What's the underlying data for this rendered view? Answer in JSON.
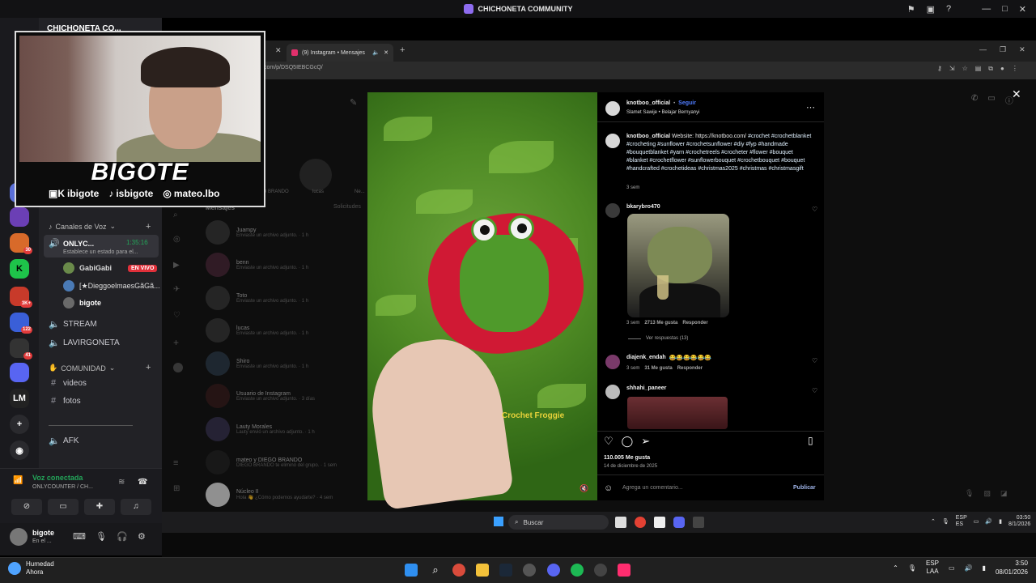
{
  "window": {
    "title": "CHICHONETA COMMUNITY"
  },
  "server": {
    "name": "CHICHONETA CO..."
  },
  "webcam": {
    "label": "BIGOTE",
    "socials": [
      {
        "icon": "twitch-kick-icon",
        "handle": "ibigote"
      },
      {
        "icon": "tiktok-icon",
        "handle": "isbigote"
      },
      {
        "icon": "instagram-icon",
        "handle": "mateo.lbo"
      }
    ]
  },
  "guild_badges": [
    "30",
    "3K+",
    "122",
    "41"
  ],
  "guild_letters": {
    "lm": "LM"
  },
  "channels": {
    "voice_header": "Canales de Voz",
    "active_voice": {
      "name": "ONLYC...",
      "timer": "1:35:16",
      "status": "Establece un estado para el..."
    },
    "members": [
      {
        "name": "GabiGabi",
        "live": "EN VIVO"
      },
      {
        "name": "[★Dieggoelmaes​Gã​Gã..."
      },
      {
        "name": "bigote"
      }
    ],
    "voice_channels": [
      "STREAM",
      "LAVIRGONETA"
    ],
    "community_header": "COMUNIDAD",
    "text_channels": [
      "videos",
      "fotos"
    ],
    "afk": "AFK"
  },
  "voice_panel": {
    "status": "Voz conectada",
    "channel": "ONLYCOUNTER / CH..."
  },
  "user_bar": {
    "name": "bigote",
    "status": "En el ..."
  },
  "browser": {
    "tab_title": "(9) Instagram • Mensajes",
    "url": "com/p/DSQ5IEBCGcQ/"
  },
  "instagram": {
    "messages_header": "Mensajes",
    "requests": "Solicitudes",
    "stories": [
      "DIEGO BRANDO",
      "lucas",
      "Ne..."
    ],
    "dms": [
      {
        "name": "Juampy",
        "sub": "Enviaste un archivo adjunto. · 1 h"
      },
      {
        "name": "benn",
        "sub": "Enviaste un archivo adjunto. · 1 h"
      },
      {
        "name": "Toto",
        "sub": "Enviaste un archivo adjunto. · 1 h"
      },
      {
        "name": "lucas",
        "sub": "Enviaste un archivo adjunto. · 1 h"
      },
      {
        "name": "Shiro",
        "sub": "Enviaste un archivo adjunto. · 1 h"
      },
      {
        "name": "Usuario de Instagram",
        "sub": "Enviaste un archivo adjunto. · 3 días"
      },
      {
        "name": "Lauty Morales",
        "sub": "Lauty envió un archivo adjunto. · 1 h"
      },
      {
        "name": "mateo y DIEGO BRANDO",
        "sub": "DIEGO BRANDO te eliminó del grupo. · 1 sem"
      },
      {
        "name": "Núcleo II",
        "sub": "Hola 👋 ¿Cómo podemos ayudarte? · 4 sem"
      }
    ],
    "post": {
      "username": "knotboo_official",
      "follow": "Seguir",
      "audio": "Slamet Sawije • Belajar Bernyanyi",
      "caption_prefix": "Website: https://knotboo.com/",
      "hashtags": "#crochet #crochetblanket #crocheting #sunflower #crochetsunflower #diy #fyp #handmade #bouquetblanket #yarn #crochetreels #crocheter #flower #bouquet #blanket #crochetflower #sunflowerbouquet #crochetbouquet #bouquet #handcrafted #crochetideas #christmas2025 #christmas #christmasgift",
      "caption_time": "3 sem",
      "image_overlay_text": "Crochet Froggie",
      "comments": [
        {
          "user": "bkarybro470",
          "time": "3 sem",
          "likes": "2713 Me gusta",
          "reply": "Responder",
          "view_replies": "Ver respuestas (13)"
        },
        {
          "user": "diajenk_endah",
          "text": "😂😂😂😂😂😂",
          "time": "3 sem",
          "likes": "31 Me gusta",
          "reply": "Responder"
        },
        {
          "user": "shhahi_paneer"
        }
      ],
      "likes": "110.005 Me gusta",
      "date": "14 de diciembre de 2025",
      "comment_placeholder": "Agrega un comentario...",
      "publish": "Publicar"
    }
  },
  "inner_taskbar": {
    "search": "Buscar",
    "lang": "ESP\nES",
    "time": "03:50",
    "date": "8/1/2026"
  },
  "taskbar": {
    "weather": {
      "label": "Humedad",
      "sub": "Ahora"
    },
    "lang_top": "ESP",
    "lang_bottom": "LAA",
    "time": "3:50",
    "date": "08/01/2026"
  },
  "colors": {
    "instagram_blue": "#4f7cff",
    "live_red": "#e0303a",
    "discord_green": "#23a559",
    "hood_red": "#d01934",
    "frog_green": "#4f9a2b"
  }
}
